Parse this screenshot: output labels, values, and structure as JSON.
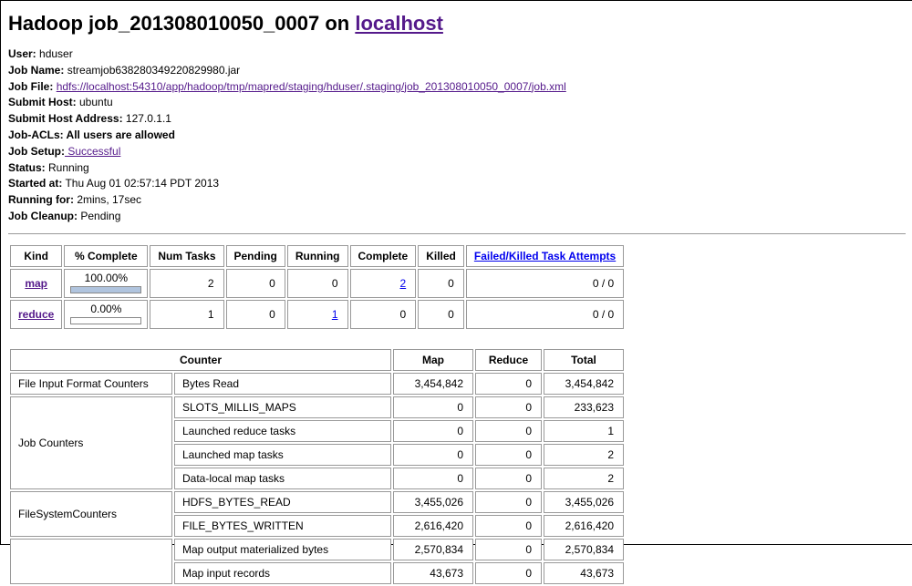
{
  "header": {
    "prefix": "Hadoop ",
    "job_id": "job_201308010050_0007",
    "middle": " on ",
    "host_link": "localhost"
  },
  "meta": {
    "user_label": "User:",
    "user_value": " hduser",
    "jobname_label": "Job Name:",
    "jobname_value": " streamjob638280349220829980.jar",
    "jobfile_label": "Job File:",
    "jobfile_link": "hdfs://localhost:54310/app/hadoop/tmp/mapred/staging/hduser/.staging/job_201308010050_0007/job.xml",
    "submithost_label": "Submit Host:",
    "submithost_value": " ubuntu",
    "submithostaddr_label": "Submit Host Address:",
    "submithostaddr_value": " 127.0.1.1",
    "jobacls_label": "Job-ACLs: All users are allowed",
    "jobsetup_label": "Job Setup:",
    "jobsetup_link": " Successful",
    "status_label": "Status:",
    "status_value": " Running",
    "startedat_label": "Started at:",
    "startedat_value": " Thu Aug 01 02:57:14 PDT 2013",
    "runningfor_label": "Running for:",
    "runningfor_value": " 2mins, 17sec",
    "jobcleanup_label": "Job Cleanup:",
    "jobcleanup_value": " Pending"
  },
  "progress_headers": {
    "kind": "Kind",
    "pct": "% Complete",
    "num": "Num Tasks",
    "pending": "Pending",
    "running": "Running",
    "complete": "Complete",
    "killed": "Killed",
    "failed": "Failed/Killed Task Attempts"
  },
  "progress": [
    {
      "kind": "map",
      "pct": "100.00%",
      "pct_width": "100%",
      "num": "2",
      "pending": "0",
      "running": "0",
      "complete": "2",
      "complete_link": true,
      "killed": "0",
      "failed": "0 / 0"
    },
    {
      "kind": "reduce",
      "pct": "0.00%",
      "pct_width": "0%",
      "num": "1",
      "pending": "0",
      "running": "1",
      "running_link": true,
      "complete": "0",
      "killed": "0",
      "failed": "0 / 0"
    }
  ],
  "counter_headers": {
    "counter": "Counter",
    "map": "Map",
    "reduce": "Reduce",
    "total": "Total"
  },
  "counters": [
    {
      "group": "File Input Format Counters",
      "rowspan": 1,
      "rows": [
        {
          "name": "Bytes Read",
          "map": "3,454,842",
          "reduce": "0",
          "total": "3,454,842"
        }
      ]
    },
    {
      "group": "Job Counters",
      "rowspan": 4,
      "rows": [
        {
          "name": "SLOTS_MILLIS_MAPS",
          "map": "0",
          "reduce": "0",
          "total": "233,623"
        },
        {
          "name": "Launched reduce tasks",
          "map": "0",
          "reduce": "0",
          "total": "1"
        },
        {
          "name": "Launched map tasks",
          "map": "0",
          "reduce": "0",
          "total": "2"
        },
        {
          "name": "Data-local map tasks",
          "map": "0",
          "reduce": "0",
          "total": "2"
        }
      ]
    },
    {
      "group": "FileSystemCounters",
      "rowspan": 2,
      "rows": [
        {
          "name": "HDFS_BYTES_READ",
          "map": "3,455,026",
          "reduce": "0",
          "total": "3,455,026"
        },
        {
          "name": "FILE_BYTES_WRITTEN",
          "map": "2,616,420",
          "reduce": "0",
          "total": "2,616,420"
        }
      ]
    },
    {
      "group": "",
      "rowspan": 2,
      "rows": [
        {
          "name": "Map output materialized bytes",
          "map": "2,570,834",
          "reduce": "0",
          "total": "2,570,834"
        },
        {
          "name": "Map input records",
          "map": "43,673",
          "reduce": "0",
          "total": "43,673"
        }
      ]
    }
  ]
}
